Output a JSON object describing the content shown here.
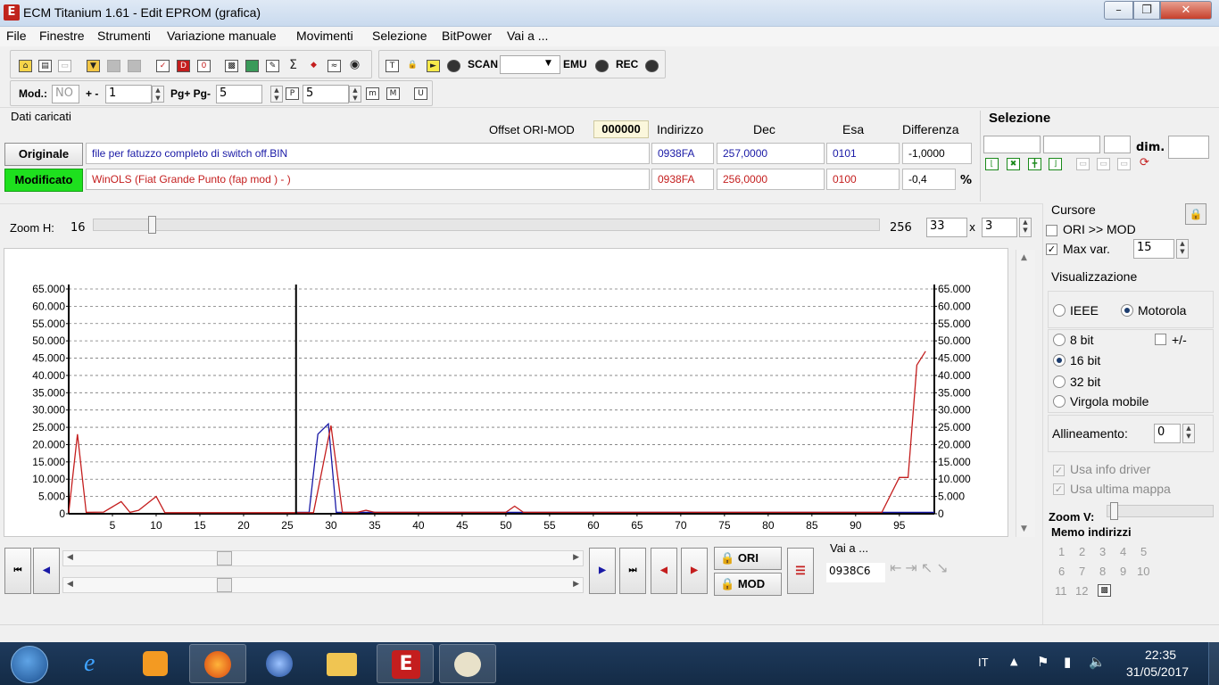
{
  "window": {
    "title": "ECM Titanium 1.61 - Edit EPROM (grafica)"
  },
  "menu": [
    "File",
    "Finestre",
    "Strumenti",
    "Variazione manuale",
    "Movimenti",
    "Selezione",
    "BitPower",
    "Vai a ..."
  ],
  "toolbar": {
    "scan_label": "SCAN",
    "emu_label": "EMU",
    "rec_label": "REC",
    "scan_value": ""
  },
  "toolbar2": {
    "mod_label": "Mod.:",
    "mod_value": "NO",
    "plusminus_label": "+ -",
    "plusminus_value": "1",
    "pg_label": "Pg+ Pg-",
    "pg_value": "5",
    "p_value": "5"
  },
  "dati": {
    "title": "Dati caricati",
    "offset_label": "Offset ORI-MOD",
    "offset_value": "000000",
    "col_indirizzo": "Indirizzo",
    "col_dec": "Dec",
    "col_esa": "Esa",
    "col_differenza": "Differenza",
    "originale": {
      "label": "Originale",
      "file": "file per fatuzzo completo di switch off.BIN",
      "indirizzo": "0938FA",
      "dec": "257,0000",
      "esa": "0101",
      "differenza": "-1,0000"
    },
    "modificato": {
      "label": "Modificato",
      "file": "WinOLS (Fiat Grande Punto (fap mod ) - )",
      "indirizzo": "0938FA",
      "dec": "256,0000",
      "esa": "0100",
      "differenza": "-0,4",
      "unit": "%"
    }
  },
  "selezione": {
    "title": "Selezione",
    "dim_label": "dim."
  },
  "zoom": {
    "label": "Zoom H:",
    "value": "16",
    "max": "256",
    "w": "33",
    "x_label": "x",
    "h": "3"
  },
  "cursore": {
    "title": "Cursore",
    "ori_mod_label": "ORI >> MOD",
    "ori_mod_checked": false,
    "maxvar_label": "Max var.",
    "maxvar_checked": true,
    "maxvar_value": "15"
  },
  "visualizzazione": {
    "title": "Visualizzazione",
    "ieee": "IEEE",
    "motorola": "Motorola",
    "byte_order": "Motorola",
    "bit8": "8 bit",
    "bit16": "16 bit",
    "bit32": "32 bit",
    "virgola": "Virgola mobile",
    "word": "16 bit",
    "signed_label": "+/-",
    "allineamento_label": "Allineamento:",
    "allineamento_value": "0",
    "usa_info_driver": "Usa info driver",
    "usa_ultima_mappa": "Usa ultima mappa"
  },
  "zoomv": {
    "label": "Zoom V:"
  },
  "memo": {
    "title": "Memo indirizzi",
    "slots": [
      "1",
      "2",
      "3",
      "4",
      "5",
      "6",
      "7",
      "8",
      "9",
      "10",
      "11",
      "12"
    ]
  },
  "vai": {
    "label": "Vai a ...",
    "value": "0938C6"
  },
  "bottom": {
    "ori_label": "ORI",
    "mod_label": "MOD"
  },
  "taskbar": {
    "lang": "IT",
    "time": "22:35",
    "date": "31/05/2017"
  },
  "colors": {
    "ori": "#1a1aa6",
    "mod": "#c41e1e",
    "modificato_bg": "#1ee01e"
  },
  "chart_data": {
    "type": "line",
    "x_ticks": [
      "5",
      "10",
      "15",
      "20",
      "25",
      "30",
      "35",
      "40",
      "45",
      "50",
      "55",
      "60",
      "65",
      "70",
      "75",
      "80",
      "85",
      "90",
      "95"
    ],
    "y_ticks": [
      "0",
      "5.000",
      "10.000",
      "15.000",
      "20.000",
      "25.000",
      "30.000",
      "35.000",
      "40.000",
      "45.000",
      "50.000",
      "55.000",
      "60.000",
      "65.000"
    ],
    "xlim": [
      0,
      99
    ],
    "ylim": [
      0,
      65000
    ],
    "grid": true,
    "cursor_x": 26,
    "series": [
      {
        "id": "ori",
        "color": "#1a1aa6",
        "points": [
          [
            26,
            400
          ],
          [
            27.5,
            400
          ],
          [
            28.5,
            23000
          ],
          [
            29.7,
            26000
          ],
          [
            30.6,
            400
          ],
          [
            99,
            400
          ]
        ]
      },
      {
        "id": "mod",
        "color": "#c41e1e",
        "points": [
          [
            0,
            300
          ],
          [
            1,
            23000
          ],
          [
            2,
            400
          ],
          [
            4,
            500
          ],
          [
            6,
            3500
          ],
          [
            7,
            400
          ],
          [
            8,
            1000
          ],
          [
            10,
            5000
          ],
          [
            11,
            300
          ],
          [
            26,
            300
          ],
          [
            28,
            300
          ],
          [
            30,
            25500
          ],
          [
            31.3,
            400
          ],
          [
            33,
            400
          ],
          [
            34,
            1000
          ],
          [
            35,
            400
          ],
          [
            50,
            400
          ],
          [
            51,
            2200
          ],
          [
            52,
            400
          ],
          [
            93,
            400
          ],
          [
            95,
            10500
          ],
          [
            96,
            10500
          ],
          [
            97,
            43000
          ],
          [
            98,
            47000
          ]
        ]
      }
    ]
  }
}
